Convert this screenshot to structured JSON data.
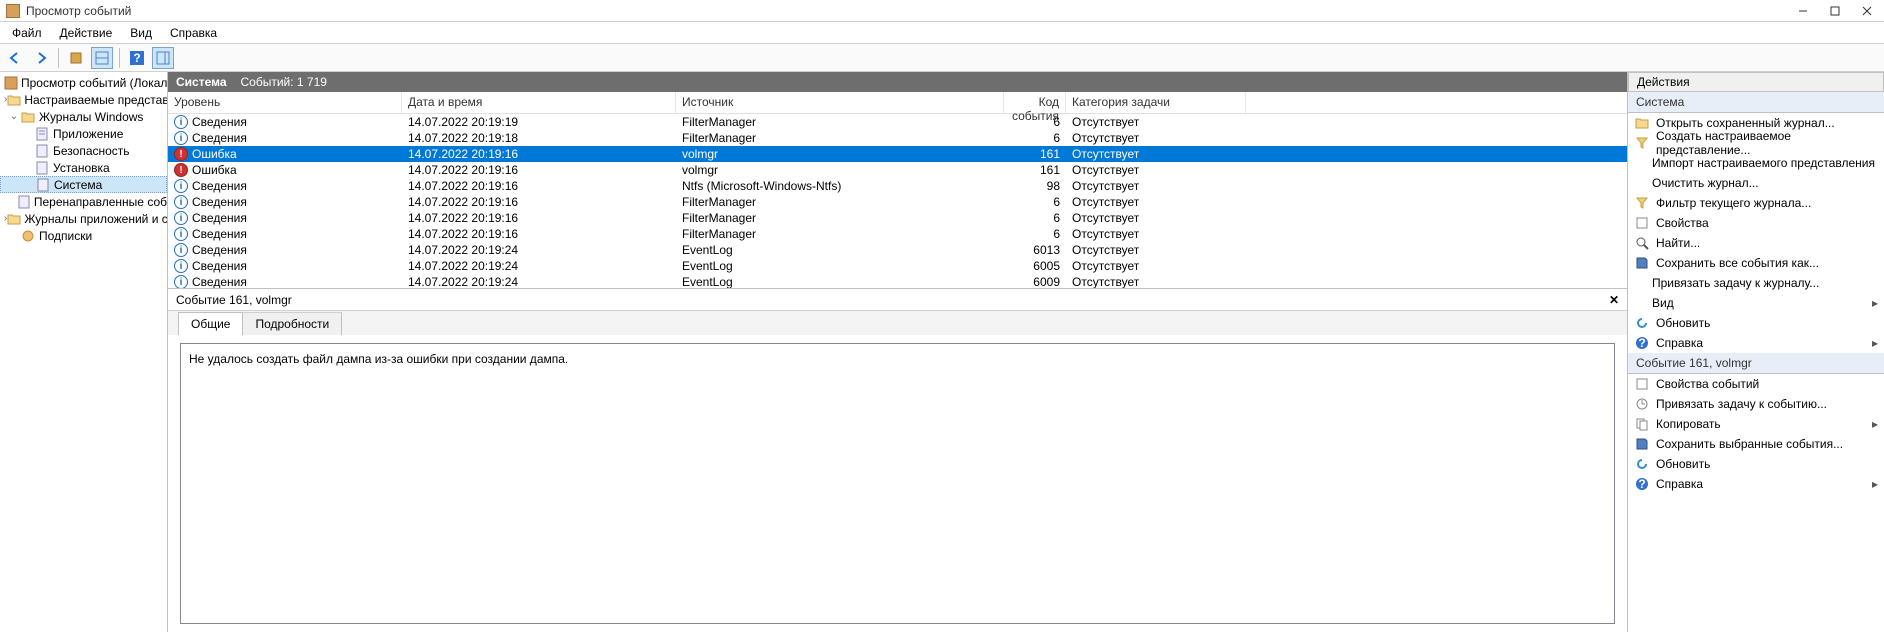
{
  "window": {
    "title": "Просмотр событий"
  },
  "menu": {
    "file": "Файл",
    "action": "Действие",
    "view": "Вид",
    "help": "Справка"
  },
  "tree": {
    "root": "Просмотр событий (Локальны",
    "custom_views": "Настраиваемые представле",
    "windows_logs": "Журналы Windows",
    "application": "Приложение",
    "security": "Безопасность",
    "setup": "Установка",
    "system": "Система",
    "forwarded": "Перенаправленные соб",
    "app_services": "Журналы приложений и сл",
    "subscriptions": "Подписки"
  },
  "center_header": {
    "title": "Система",
    "count_label": "Событий: 1 719"
  },
  "columns": {
    "level": "Уровень",
    "date": "Дата и время",
    "source": "Источник",
    "code": "Код события",
    "category": "Категория задачи"
  },
  "events": [
    {
      "level": "Сведения",
      "icon": "info",
      "date": "14.07.2022 20:19:19",
      "source": "FilterManager",
      "code": "6",
      "category": "Отсутствует"
    },
    {
      "level": "Сведения",
      "icon": "info",
      "date": "14.07.2022 20:19:18",
      "source": "FilterManager",
      "code": "6",
      "category": "Отсутствует"
    },
    {
      "level": "Ошибка",
      "icon": "error",
      "date": "14.07.2022 20:19:16",
      "source": "volmgr",
      "code": "161",
      "category": "Отсутствует",
      "selected": true
    },
    {
      "level": "Ошибка",
      "icon": "error",
      "date": "14.07.2022 20:19:16",
      "source": "volmgr",
      "code": "161",
      "category": "Отсутствует"
    },
    {
      "level": "Сведения",
      "icon": "info",
      "date": "14.07.2022 20:19:16",
      "source": "Ntfs (Microsoft-Windows-Ntfs)",
      "code": "98",
      "category": "Отсутствует"
    },
    {
      "level": "Сведения",
      "icon": "info",
      "date": "14.07.2022 20:19:16",
      "source": "FilterManager",
      "code": "6",
      "category": "Отсутствует"
    },
    {
      "level": "Сведения",
      "icon": "info",
      "date": "14.07.2022 20:19:16",
      "source": "FilterManager",
      "code": "6",
      "category": "Отсутствует"
    },
    {
      "level": "Сведения",
      "icon": "info",
      "date": "14.07.2022 20:19:16",
      "source": "FilterManager",
      "code": "6",
      "category": "Отсутствует"
    },
    {
      "level": "Сведения",
      "icon": "info",
      "date": "14.07.2022 20:19:24",
      "source": "EventLog",
      "code": "6013",
      "category": "Отсутствует"
    },
    {
      "level": "Сведения",
      "icon": "info",
      "date": "14.07.2022 20:19:24",
      "source": "EventLog",
      "code": "6005",
      "category": "Отсутствует"
    },
    {
      "level": "Сведения",
      "icon": "info",
      "date": "14.07.2022 20:19:24",
      "source": "EventLog",
      "code": "6009",
      "category": "Отсутствует"
    }
  ],
  "detail": {
    "title": "Событие 161, volmgr",
    "tab_general": "Общие",
    "tab_details": "Подробности",
    "message": "Не удалось создать файл дампа из-за ошибки при создании дампа."
  },
  "actions": {
    "title": "Действия",
    "section1": "Система",
    "open_saved": "Открыть сохраненный журнал...",
    "create_view": "Создать настраиваемое представление...",
    "import_view": "Импорт настраиваемого представления",
    "clear_log": "Очистить журнал...",
    "filter_log": "Фильтр текущего журнала...",
    "properties": "Свойства",
    "find": "Найти...",
    "save_all": "Сохранить все события как...",
    "attach_task": "Привязать задачу к журналу...",
    "view": "Вид",
    "refresh": "Обновить",
    "help": "Справка",
    "section2": "Событие 161, volmgr",
    "event_props": "Свойства событий",
    "attach_event_task": "Привязать задачу к событию...",
    "copy": "Копировать",
    "save_selected": "Сохранить выбранные события...",
    "refresh2": "Обновить",
    "help2": "Справка"
  }
}
